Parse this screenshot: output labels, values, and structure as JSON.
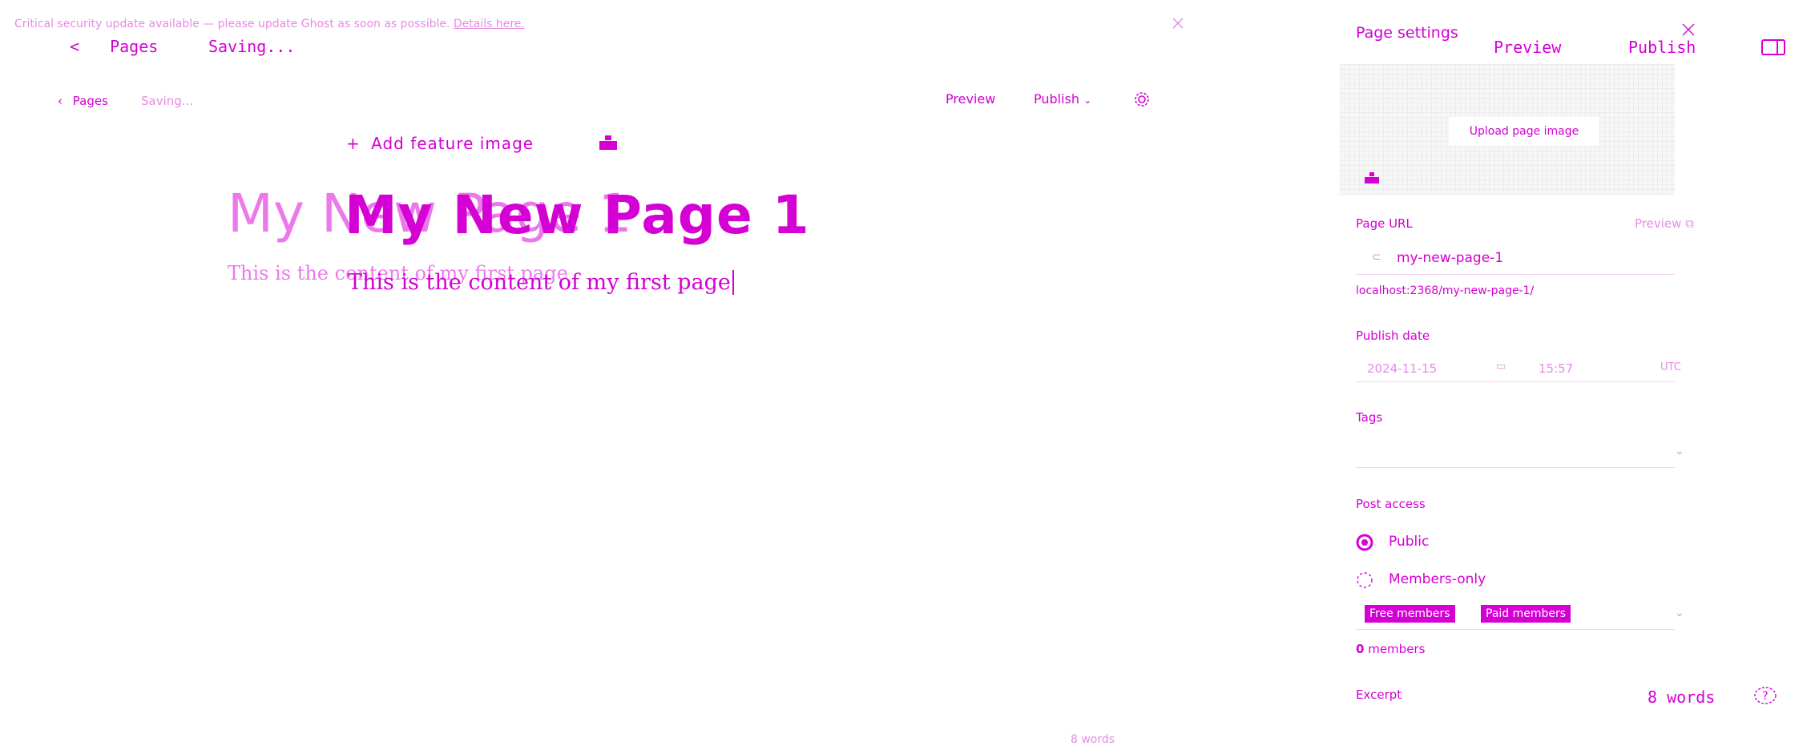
{
  "banner": {
    "text": "Critical security update available — please update Ghost as soon as possible.",
    "link": "Details here."
  },
  "ghost_header": {
    "back_label": "Pages",
    "status": "Saving...",
    "preview": "Preview",
    "publish": "Publish"
  },
  "header": {
    "back_label": "Pages",
    "status": "Saving...",
    "preview": "Preview",
    "publish": "Publish"
  },
  "editor": {
    "add_feature_image": "Add feature image",
    "title": "My New Page 1",
    "body": "This is the content of my first page"
  },
  "footer": {
    "word_count": "8 words",
    "help_icon": "?"
  },
  "settings": {
    "title": "Page settings",
    "upload_label": "Upload page image",
    "url_label": "Page URL",
    "url_preview": "Preview",
    "slug": "my-new-page-1",
    "full_url": "localhost:2368/my-new-page-1/",
    "publish_date_label": "Publish date",
    "date": "2024-11-15",
    "time": "15:57",
    "timezone": "UTC",
    "tags_label": "Tags",
    "access_label": "Post access",
    "access_public": "Public",
    "access_members": "Members-only",
    "tiers": [
      "Free members",
      "Paid members"
    ],
    "members_count": "0",
    "members_label": "members",
    "excerpt_label": "Excerpt"
  },
  "colors": {
    "accent": "#d400d4",
    "text": "#d400d4"
  }
}
